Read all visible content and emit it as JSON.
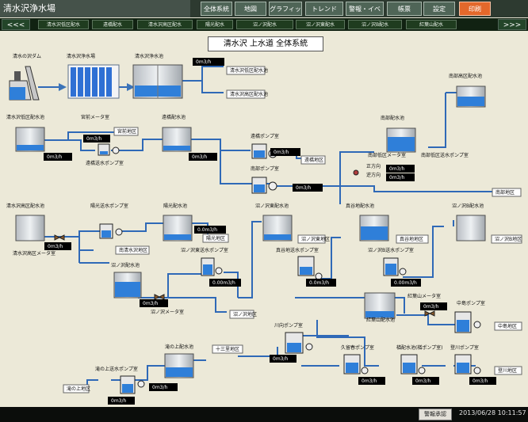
{
  "app": {
    "title": "清水沢浄水場"
  },
  "nav": [
    "全体系統",
    "地図",
    "グラフィック",
    "トレンド",
    "警報・イベント",
    "帳票",
    "設定",
    "印刷"
  ],
  "tabs": {
    "prev": "<<<",
    "next": ">>>",
    "items": [
      "清水沢低区配水",
      "遠橋配水",
      "清水沢高区配水",
      "陽光配水",
      "沼ノ沢配水",
      "沼ノ沢東配水",
      "沼ノ沢B配水",
      "紅葉山配水"
    ]
  },
  "page": {
    "title": "清水沢 上水道 全体系統"
  },
  "diagram": {
    "labels": {
      "dam": "清水の沢ダム",
      "intake": "清水沢浄水場",
      "plant": "清水沢浄水池",
      "low_tank": "清水沢低区配水池",
      "miyamae_meter": "宮前メータ室",
      "tonohashi_tank": "遠橋配水池",
      "tonohashi_send_pump": "遠橋送水ポンプ室",
      "tonohashi_pump": "遠橋ポンプ室",
      "nanbu_pump": "南部ポンプ室",
      "nanbu_high_tank": "南部高区配水池",
      "nanbu_tank": "南部配水池",
      "nanbu_meter": "南部低区メータ室",
      "nanbu_send_pump": "南部低区送水ポンプ室",
      "forward": "正方向",
      "reverse": "逆方向",
      "high_tank": "清水沢高区配水池",
      "high_meter": "清水沢高区メータ室",
      "yoko_send_pump": "陽光送水ポンプ室",
      "yoko_tank": "陽光配水池",
      "numanosawa_tank": "沼ノ沢配水池",
      "numanosawa_meter": "沼ノ沢メータ室",
      "numanosawa_east_tank": "沼ノ沢東配水池",
      "numanosawa_east_pump": "沼ノ沢東送水ポンプ室",
      "shingayama_tank": "真谷地配水池",
      "shingayama_pump": "真谷地送水ポンプ室",
      "numanosawa_b_tank": "沼ノ沢B配水池",
      "numanosawa_b_pump": "沼ノ沢B送水ポンプ室",
      "koyosan_meter": "紅葉山メータ室",
      "koyosan_tank": "紅葉山配水池",
      "nakajima_pump": "中島ポンプ室",
      "kawamukai_pump": "川向ポンプ室",
      "kuboharu_pump": "久留春ポンプ室",
      "kurazawa_pump": "楢配水池(楢ポンプ室)",
      "noborikawa_pump": "登川ポンプ室",
      "takinoue_tank": "滝の上配水池",
      "takinoue_send_pump": "滝の上送水ポンプ室"
    },
    "districts": {
      "shimizusawa_low_a": "清水沢低区配水池",
      "shimizusawa_low_b": "清水沢高区配水池",
      "miyamae": "宮前地区",
      "tonohashi": "遠橋地区",
      "nanbu": "南部地区",
      "minami_shimizusawa": "南清水沢地区",
      "yoko": "陽光地区",
      "numanosawa_east": "沼ノ沢東地区",
      "shingayama": "真谷地地区",
      "numanosawa_b": "沼ノ沢B地区",
      "numanosawa": "沼ノ沢地区",
      "jusanri": "十三里地区",
      "takinoue": "滝の上地区",
      "nakajima": "中島地区",
      "noborikawa": "登川地区"
    },
    "flows": {
      "plant": "0m3/h",
      "low_tank": "0m3/h",
      "miyamae": "0m3/h",
      "tonohashi_tank": "0m3/h",
      "tonohashi_pump": "0m3/h",
      "nanbu_pump": "0m3/h",
      "forward": "0m3/h",
      "reverse": "0m3/h",
      "high_meter": "0m3/h",
      "yoko": "0.0m3/h",
      "numanosawa_meter": "0m3/h",
      "numanosawa_east": "0.00m3/h",
      "shingayama": "0.0m3/h",
      "numanosawa_b": "0.00m3/h",
      "koyosan": "0m3/h",
      "kawamukai": "0m3/h",
      "kuboharu": "0m3/h",
      "kurazawa": "0m3/h",
      "noborikawa": "0m3/h",
      "takinoue_tank": "0m3/h",
      "takinoue_send": "0m3/h"
    }
  },
  "status": {
    "alarm_ack": "警報承認",
    "datetime": "2013/06/28 10:11:57"
  },
  "colors": {
    "background": "#ece9d8",
    "pipe": "#2f69b7",
    "water": "#2f7fd9",
    "print_button": "#e3682b",
    "header": "#2d3a30"
  }
}
